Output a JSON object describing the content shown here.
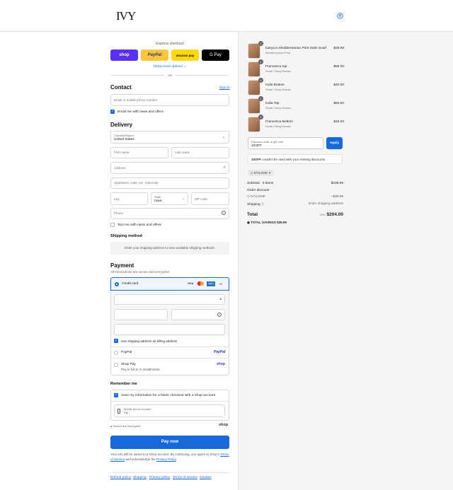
{
  "brand": {
    "logo": "IVY"
  },
  "checkout": {
    "express_title": "Express checkout",
    "express_buttons": [
      "shop",
      "PayPal",
      "amazon pay",
      "G Pay"
    ],
    "show_more": "Show more options ⌄",
    "or": "OR",
    "contact": {
      "title": "Contact",
      "sign_in": "Sign in",
      "placeholder": "Email or mobile phone number",
      "news": "Email me with news and offers"
    },
    "delivery": {
      "title": "Delivery",
      "country_label": "Country/Region",
      "country": "United States",
      "first_name": "First name",
      "last_name": "Last name",
      "address": "Address",
      "apartment": "Apartment, suite, etc. (optional)",
      "city": "City",
      "state_label": "State",
      "state": "Iowa",
      "zip": "ZIP code",
      "phone": "Phone",
      "text_news": "Text me with news and offers"
    },
    "shipping": {
      "title": "Shipping method",
      "note": "Enter your shipping address to view available shipping methods."
    },
    "payment": {
      "title": "Payment",
      "subtitle": "All transactions are secure and encrypted.",
      "credit_card": "Credit card",
      "card_brands": [
        "VISA",
        "MC",
        "AMEX",
        "+5"
      ],
      "billing_same": "Use shipping address as billing address",
      "paypal": "PayPal",
      "paypal_logo": "PayPal",
      "shop_pay": "Shop Pay",
      "shop_pay_sub": "Pay in full or in installments",
      "shop_logo": "shop"
    },
    "remember": {
      "title": "Remember me",
      "save": "Save my information for a faster checkout with a Shop account",
      "mobile_label": "Mobile phone number",
      "mobile_value": "+1",
      "secure": "Secure and encrypted",
      "shop_logo": "shop"
    },
    "pay_now": "Pay now",
    "legal_1": "Your info will be saved to a Shop account. By continuing, you agree to Shop's",
    "legal_tos": "Terms of Service",
    "legal_2": "and acknowledge the",
    "legal_privacy": "Privacy Policy",
    "footer_links": [
      "Refund policy",
      "Shipping",
      "Privacy policy",
      "Terms of service",
      "Contact"
    ]
  },
  "summary": {
    "items": [
      {
        "qty": "1",
        "name": "Darya in Mediterranean Print Satin Scarf",
        "variant": "Mediterranean Print",
        "price": "$29.99"
      },
      {
        "qty": "1",
        "name": "Francesca top",
        "variant": "Small / Navy Mosaic",
        "price": "$65.00"
      },
      {
        "qty": "1",
        "name": "India Bottom",
        "variant": "Small / Navy Mosaic",
        "price": "$40.00"
      },
      {
        "qty": "1",
        "name": "India Top",
        "variant": "Small / Navy Mosaic",
        "price": "$60.00"
      },
      {
        "qty": "1",
        "name": "Francesca Bottom",
        "variant": "Small / Navy Mosaic",
        "price": "$45.00"
      }
    ],
    "discount_label": "Discount code or gift card",
    "discount_value": "10OFF",
    "apply": "Apply",
    "discount_error_code": "10OFF",
    "discount_error": "couldn't be used with your existing discounts.",
    "applied_code": "IVYLOVE",
    "subtotal_label": "Subtotal · 5 items",
    "subtotal": "$239.99",
    "order_discount_label": "Order discount",
    "discount_code": "IVYLOVE",
    "discount_amount": "−$35.99",
    "shipping_label": "Shipping",
    "shipping_value": "Enter shipping address",
    "total_label": "Total",
    "currency": "USD",
    "total": "$204.00",
    "savings_label": "TOTAL SAVINGS",
    "savings": "$35.99"
  },
  "colors": {
    "accent": "#1769d9",
    "shop": "#5a31f4",
    "paypal": "#ffc439",
    "amazon": "#ffd814"
  }
}
